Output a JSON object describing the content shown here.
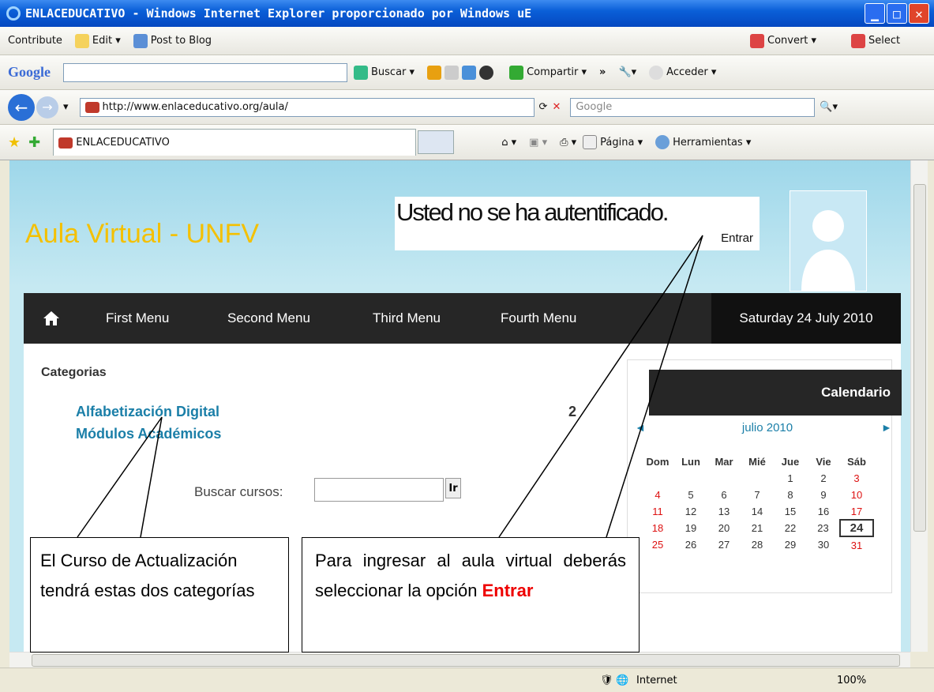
{
  "window": {
    "title": "ENLACEDUCATIVO - Windows Internet Explorer proporcionado por Windows uE"
  },
  "toolbar1": {
    "contribute": "Contribute",
    "edit": "Edit",
    "post": "Post to Blog",
    "convert": "Convert",
    "select": "Select"
  },
  "google_bar": {
    "logo": "Google",
    "buscar": "Buscar",
    "compartir": "Compartir",
    "acceder": "Acceder"
  },
  "address": {
    "url": "http://www.enlaceducativo.org/aula/",
    "search_placeholder": "Google"
  },
  "tabs": {
    "active_tab": "ENLACEDUCATIVO"
  },
  "commandbar": {
    "pagina": "Página",
    "herramientas": "Herramientas"
  },
  "site": {
    "title": "Aula Virtual - UNFV",
    "auth_message": "Usted no se ha autentificado.",
    "enter_link": "Entrar",
    "menu": [
      "First Menu",
      "Second Menu",
      "Third Menu",
      "Fourth Menu"
    ],
    "date": "Saturday 24 July 2010"
  },
  "categories": {
    "title": "Categorias",
    "items": [
      "Alfabetización Digital",
      "Módulos Académicos"
    ],
    "count": "2",
    "search_label": "Buscar cursos:",
    "search_button": "Ir"
  },
  "calendar": {
    "title": "Calendario",
    "month": "julio 2010",
    "weekdays": [
      "Dom",
      "Lun",
      "Mar",
      "Mié",
      "Jue",
      "Vie",
      "Sáb"
    ],
    "weeks": [
      [
        "",
        "",
        "",
        "",
        "1",
        "2",
        "3"
      ],
      [
        "4",
        "5",
        "6",
        "7",
        "8",
        "9",
        "10"
      ],
      [
        "11",
        "12",
        "13",
        "14",
        "15",
        "16",
        "17"
      ],
      [
        "18",
        "19",
        "20",
        "21",
        "22",
        "23",
        "24"
      ],
      [
        "25",
        "26",
        "27",
        "28",
        "29",
        "30",
        "31"
      ]
    ],
    "today": "24"
  },
  "callouts": {
    "left": "El Curso de Actualización tendrá estas dos categorías",
    "right_text": "Para ingresar al aula virtual deberás seleccionar la opción",
    "right_highlight": "Entrar"
  },
  "statusbar": {
    "zone": "Internet",
    "zoom": "100%"
  }
}
